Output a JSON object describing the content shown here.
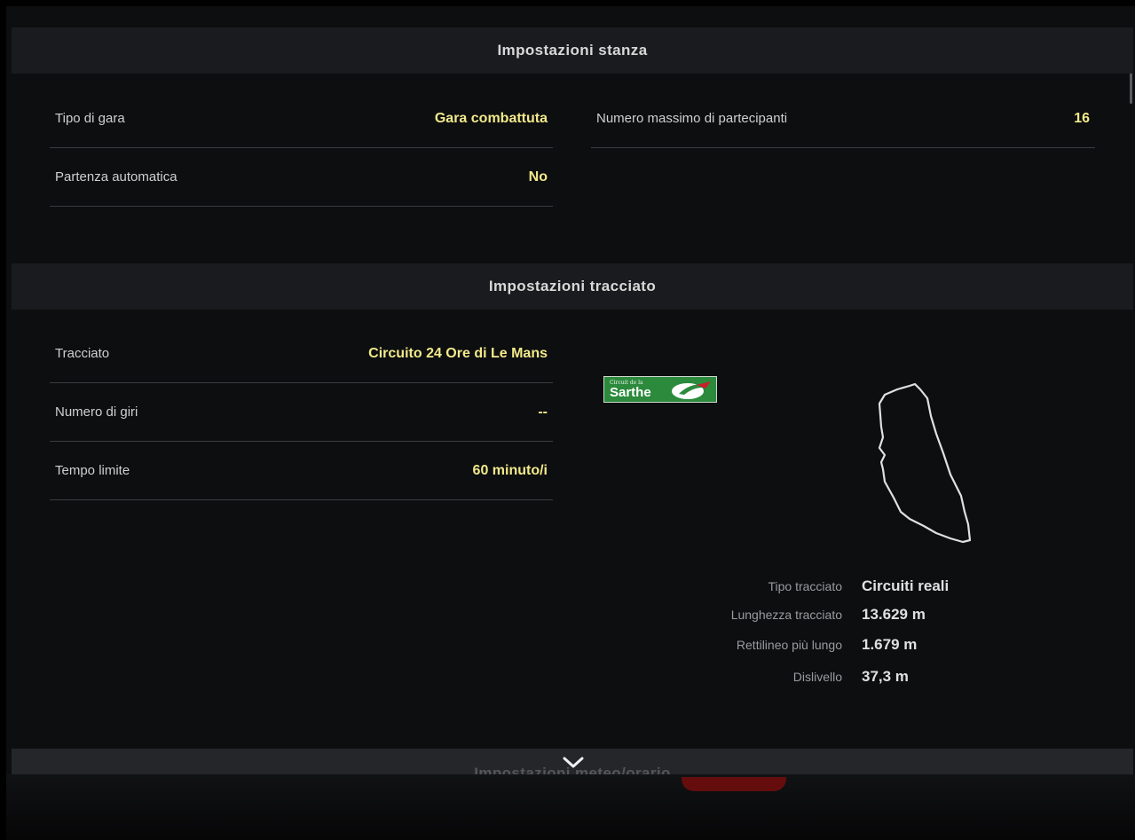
{
  "room_settings": {
    "header": "Impostazioni stanza",
    "race_type": {
      "label": "Tipo di gara",
      "value": "Gara combattuta"
    },
    "max_participants": {
      "label": "Numero massimo di partecipanti",
      "value": "16"
    },
    "auto_start": {
      "label": "Partenza automatica",
      "value": "No"
    }
  },
  "track_settings": {
    "header": "Impostazioni tracciato",
    "track": {
      "label": "Tracciato",
      "value": "Circuito 24 Ore di Le Mans"
    },
    "laps": {
      "label": "Numero di giri",
      "value": "--"
    },
    "time_limit": {
      "label": "Tempo limite",
      "value": "60 minuto/i"
    },
    "logo": {
      "small_text": "Circuit de la",
      "big_text": "Sarthe"
    },
    "details": [
      {
        "label": "Tipo tracciato",
        "value": "Circuiti reali"
      },
      {
        "label": "Lunghezza tracciato",
        "value": "13.629 m"
      },
      {
        "label": "Rettilineo più lungo",
        "value": "1.679 m"
      },
      {
        "label": "Dislivello",
        "value": "37,3 m"
      }
    ]
  },
  "next_section": {
    "header": "Impostazioni meteo/orario"
  },
  "icons": {
    "expand": "chevron-down-icon"
  },
  "colors": {
    "value_accent": "#f2e98a",
    "header_bg": "#1a1b1e",
    "background": "#0d0e10"
  }
}
